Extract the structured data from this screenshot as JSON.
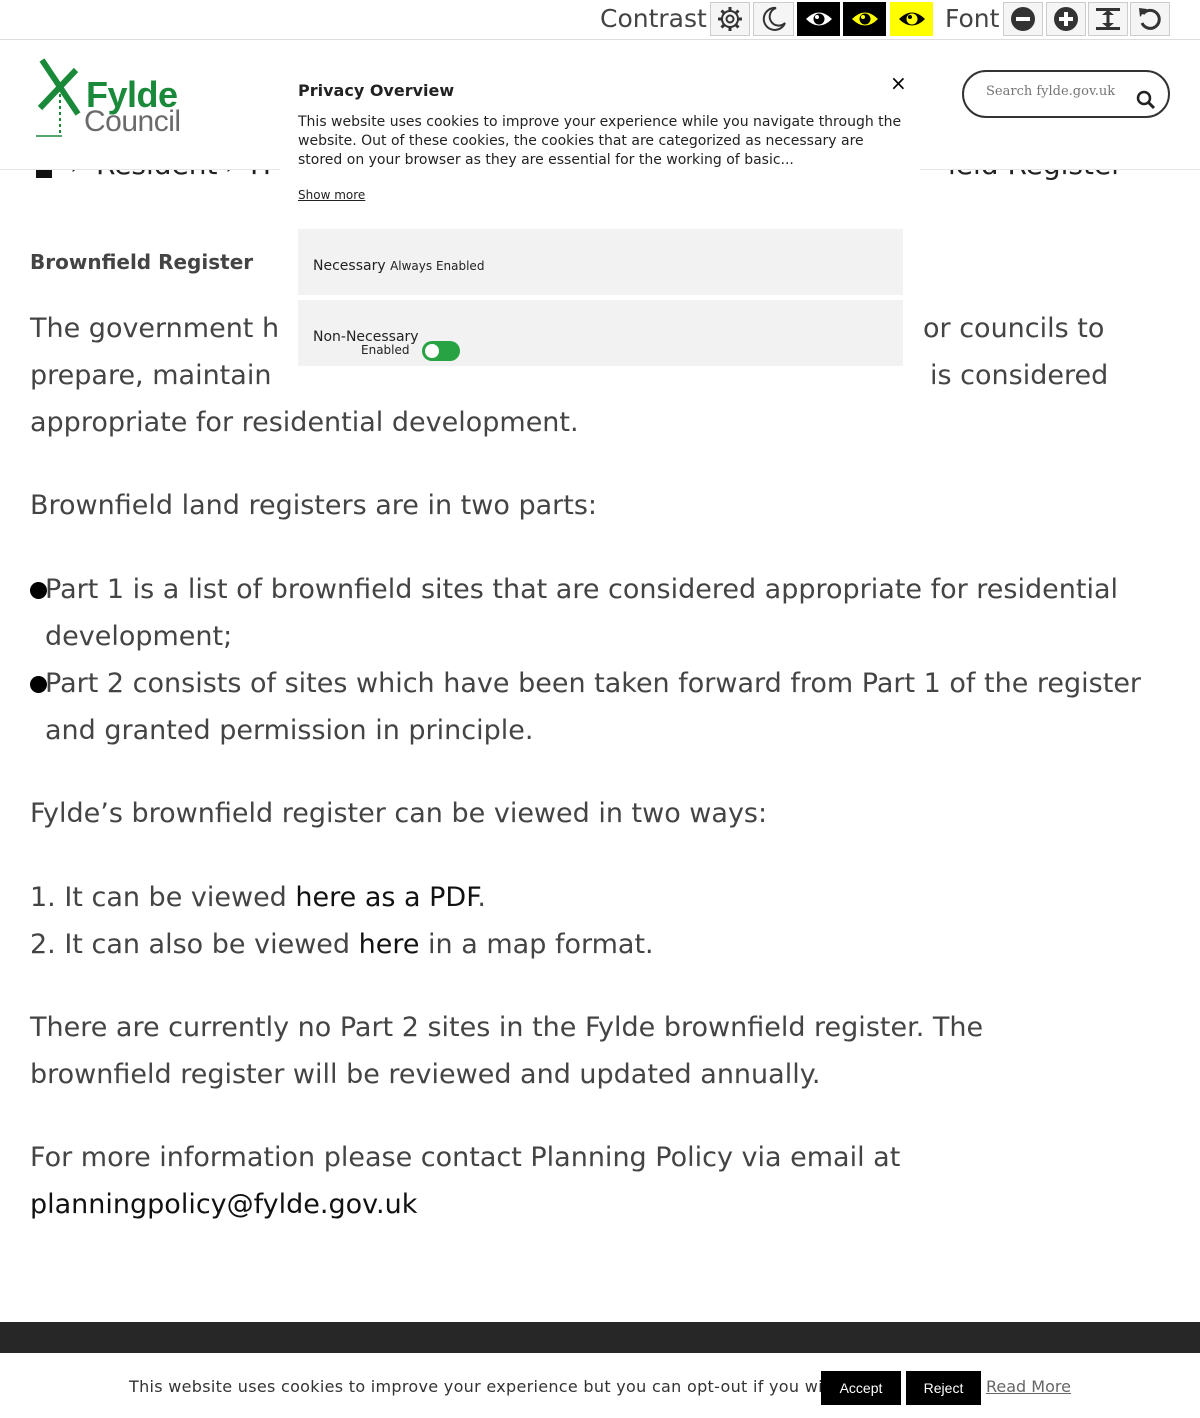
{
  "access_bar": {
    "contrast_label": "Contrast",
    "font_label": "Font",
    "buttons": [
      {
        "name": "contrast-default",
        "icon": "gear-icon"
      },
      {
        "name": "contrast-dark",
        "icon": "moon-icon"
      },
      {
        "name": "contrast-black-white",
        "icon": "eye-icon"
      },
      {
        "name": "contrast-black-yellow",
        "icon": "eye-icon"
      },
      {
        "name": "contrast-yellow-black",
        "icon": "eye-icon"
      },
      {
        "name": "font-decrease",
        "icon": "minus-circle-icon"
      },
      {
        "name": "font-increase",
        "icon": "plus-circle-icon"
      },
      {
        "name": "font-spacing",
        "icon": "text-height-icon"
      },
      {
        "name": "font-reset",
        "icon": "reset-icon"
      }
    ]
  },
  "header": {
    "logo_line1": "Fylde",
    "logo_line2": "Council",
    "search_placeholder": "Search fylde.gov.uk"
  },
  "breadcrumb": {
    "items": [
      "Resident",
      "H",
      "ield Register"
    ]
  },
  "privacy": {
    "title": "Privacy Overview",
    "close": "×",
    "body": "This website uses cookies to improve your experience while you navigate through the website. Out of these cookies, the cookies that are categorized as necessary are stored on your browser as they are essential for the working of basic...",
    "show_more": "Show more",
    "necessary_label": "Necessary",
    "necessary_status": "Always Enabled",
    "non_necessary_label": "Non-Necessary",
    "non_necessary_status": "Enabled"
  },
  "main": {
    "title": "Brownfield Register",
    "intro_left_1": "The government h",
    "intro_right_1": "or councils to",
    "intro_left_2": "prepare, maintain",
    "intro_right_2": "is considered",
    "intro_line_3": "appropriate for residential development.",
    "parts_intro": "Brownfield land registers are in two parts:",
    "bullets": [
      "Part 1 is a list of brownfield sites that are considered appropriate for residential development;",
      "Part 2 consists of sites which have been taken forward from Part 1 of the register and granted permission in principle."
    ],
    "ways_intro": "Fylde’s brownfield register can be viewed in two ways:",
    "way1_prefix": "1. It can be viewed ",
    "way1_link": "here as a PDF",
    "way1_suffix": ".",
    "way2_prefix": "2. It can also be viewed ",
    "way2_link": "here",
    "way2_suffix": " in a map format.",
    "part2_note": "There are currently no Part 2 sites in the Fylde brownfield register. The brownfield register will be reviewed and updated annually.",
    "contact_prefix": "For more information please contact Planning Policy via email at ",
    "contact_email": "planningpolicy@fylde.gov.uk"
  },
  "cookie_bar": {
    "text": "This website uses cookies to improve your experience but you can opt-out if you wish.",
    "accept": "Accept",
    "reject": "Reject",
    "read_more": "Read More"
  },
  "colors": {
    "brand_green": "#1a8a3a",
    "toggle_green": "#27a343",
    "contrast_yellow": "#ffff00",
    "footer_dark": "#272727"
  }
}
